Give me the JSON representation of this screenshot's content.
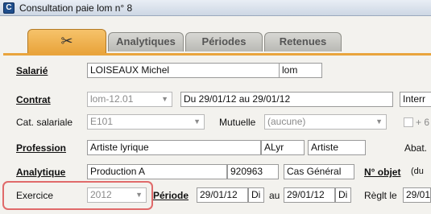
{
  "window": {
    "title": "Consultation paie lom n° 8",
    "app_icon": "C"
  },
  "tabs": [
    {
      "label": "",
      "icon": "tools-icon",
      "glyph": "✂"
    },
    {
      "label": "Analytiques"
    },
    {
      "label": "Périodes"
    },
    {
      "label": "Retenues"
    }
  ],
  "salarie": {
    "label": "Salarié",
    "name": "LOISEAUX Michel",
    "code": "lom"
  },
  "contrat": {
    "label": "Contrat",
    "code": "lom-12.01",
    "dates": "Du 29/01/12 au 29/01/12",
    "type": "Interr"
  },
  "cat": {
    "label": "Cat. salariale",
    "value": "E101",
    "mutuelle_label": "Mutuelle",
    "mutuelle_value": "(aucune)",
    "extra": "+ 6"
  },
  "profession": {
    "label": "Profession",
    "name": "Artiste lyrique",
    "code": "ALyr",
    "category": "Artiste",
    "abat_label": "Abat."
  },
  "analytique": {
    "label": "Analytique",
    "name": "Production A",
    "code": "920963",
    "type": "Cas Général",
    "objet_label": "N° objet",
    "objet_suffix": "(du"
  },
  "exercice": {
    "label": "Exercice",
    "value": "2012"
  },
  "periode": {
    "label": "Période",
    "start": "29/01/12",
    "start_unit": "Di",
    "au": "au",
    "end": "29/01/12",
    "end_unit": "Di"
  },
  "reglement": {
    "label": "Règlt le",
    "value": "29/01"
  }
}
